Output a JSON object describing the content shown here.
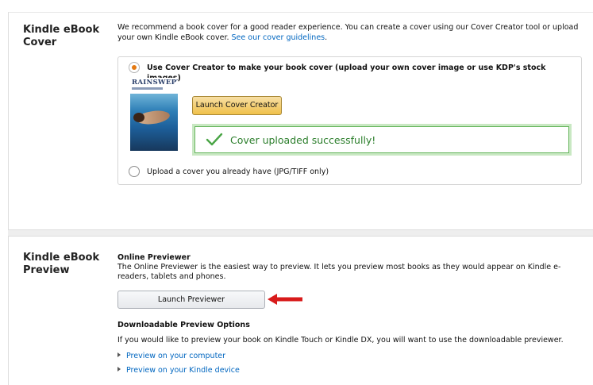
{
  "cover_section": {
    "heading": "Kindle eBook Cover",
    "intro_text": "We recommend a book cover for a good reader experience. You can create a cover using our Cover Creator tool or upload your own Kindle eBook cover.",
    "guidelines_link": "See our cover guidelines",
    "guidelines_suffix": ".",
    "option_creator": {
      "label": "Use Cover Creator to make your book cover (upload your own cover image or use KDP's stock images)",
      "selected": true
    },
    "book_thumbnail": {
      "title": "RAINSWEPT"
    },
    "launch_cover_creator_label": "Launch Cover Creator",
    "success_message": "Cover uploaded successfully!",
    "option_upload": {
      "label": "Upload a cover you already have (JPG/TIFF only)",
      "selected": false
    }
  },
  "preview_section": {
    "heading": "Kindle eBook Preview",
    "online_title": "Online Previewer",
    "online_desc": "The Online Previewer is the easiest way to preview. It lets you preview most books as they would appear on Kindle e-readers, tablets and phones.",
    "launch_previewer_label": "Launch Previewer",
    "downloadable_title": "Downloadable Preview Options",
    "downloadable_desc": "If you would like to preview your book on Kindle Touch or Kindle DX, you will want to use the downloadable previewer.",
    "links": [
      {
        "label": "Preview on your computer"
      },
      {
        "label": "Preview on your Kindle device"
      }
    ]
  },
  "colors": {
    "accent_orange": "#e47911",
    "link_blue": "#0066c0",
    "success_green": "#2b7e2b",
    "annotation_red": "#d81b1b"
  }
}
